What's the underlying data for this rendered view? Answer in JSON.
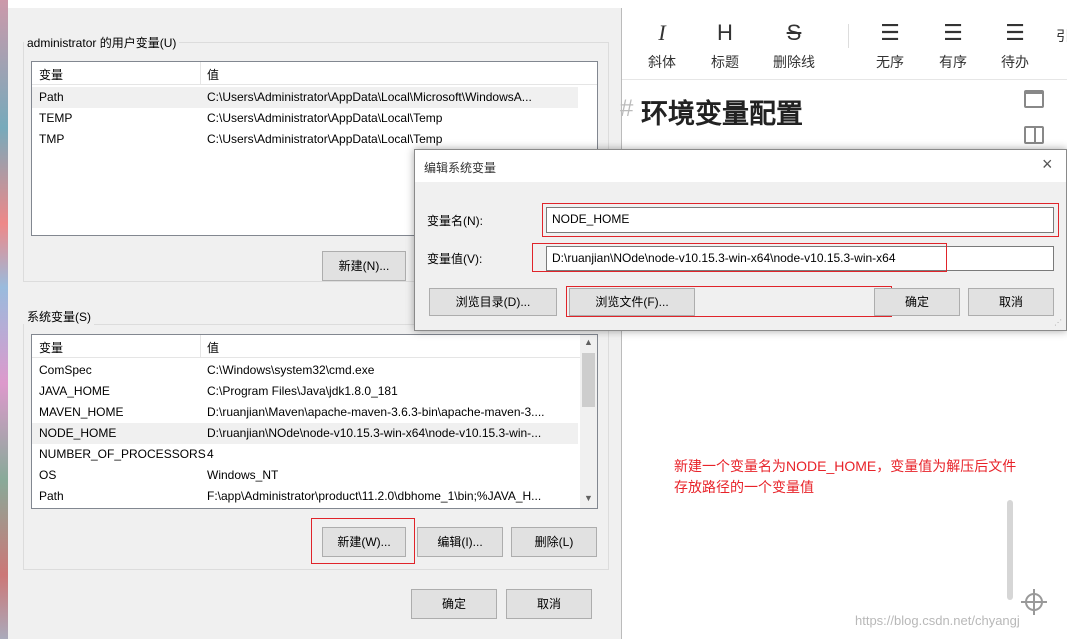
{
  "env_dialog": {
    "user_group_title": "administrator 的用户变量(U)",
    "columns": [
      "变量",
      "值"
    ],
    "user_vars": [
      {
        "name": "Path",
        "value": "C:\\Users\\Administrator\\AppData\\Local\\Microsoft\\WindowsA..."
      },
      {
        "name": "TEMP",
        "value": "C:\\Users\\Administrator\\AppData\\Local\\Temp"
      },
      {
        "name": "TMP",
        "value": "C:\\Users\\Administrator\\AppData\\Local\\Temp"
      }
    ],
    "user_new_button": "新建(N)...",
    "system_group_title": "系统变量(S)",
    "system_vars": [
      {
        "name": "ComSpec",
        "value": "C:\\Windows\\system32\\cmd.exe"
      },
      {
        "name": "JAVA_HOME",
        "value": "C:\\Program Files\\Java\\jdk1.8.0_181"
      },
      {
        "name": "MAVEN_HOME",
        "value": "D:\\ruanjian\\Maven\\apache-maven-3.6.3-bin\\apache-maven-3...."
      },
      {
        "name": "NODE_HOME",
        "value": "D:\\ruanjian\\NOde\\node-v10.15.3-win-x64\\node-v10.15.3-win-..."
      },
      {
        "name": "NUMBER_OF_PROCESSORS",
        "value": "4"
      },
      {
        "name": "OS",
        "value": "Windows_NT"
      },
      {
        "name": "Path",
        "value": "F:\\app\\Administrator\\product\\11.2.0\\dbhome_1\\bin;%JAVA_H..."
      }
    ],
    "system_new_button": "新建(W)...",
    "system_edit_button": "编辑(I)...",
    "system_delete_button": "删除(L)",
    "ok_button": "确定",
    "cancel_button": "取消"
  },
  "edit_dialog": {
    "title": "编辑系统变量",
    "close_icon": "×",
    "name_label": "变量名(N):",
    "name_value": "NODE_HOME",
    "value_label": "变量值(V):",
    "value_value": "D:\\ruanjian\\NOde\\node-v10.15.3-win-x64\\node-v10.15.3-win-x64",
    "browse_dir_button": "浏览目录(D)...",
    "browse_file_button": "浏览文件(F)...",
    "ok_button": "确定",
    "cancel_button": "取消"
  },
  "editor": {
    "toolbar": [
      {
        "icon": "I",
        "label": "斜体"
      },
      {
        "icon": "H",
        "label": "标题"
      },
      {
        "icon": "S",
        "label": "删除线"
      },
      {
        "icon": "☰",
        "label": "无序"
      },
      {
        "icon": "☰",
        "label": "有序"
      },
      {
        "icon": "☰",
        "label": "待办"
      },
      {
        "icon": "",
        "label": "引"
      }
    ],
    "heading_hash": "#",
    "heading": "环境变量配置",
    "annotation_line1": "新建一个变量名为NODE_HOME，变量值为解压后文件",
    "annotation_line2": "存放路径的一个变量值",
    "watermark": "https://blog.csdn.net/chyangj"
  }
}
